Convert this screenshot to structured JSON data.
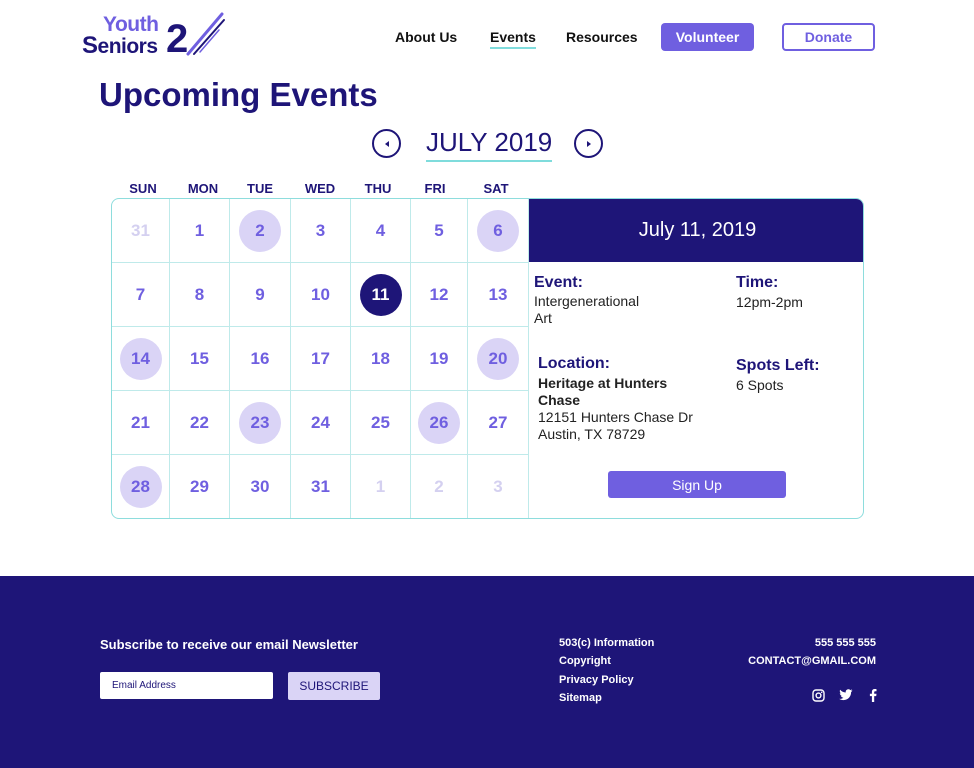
{
  "logo": {
    "word1": "Youth",
    "word2_cap": "S",
    "word2_rest": "eniors",
    "numeral": "2"
  },
  "nav": {
    "about": "About Us",
    "events": "Events",
    "resources": "Resources",
    "volunteer": "Volunteer",
    "donate": "Donate"
  },
  "page_title": "Upcoming Events",
  "calendar": {
    "month_label": "JULY 2019",
    "weekdays": [
      "SUN",
      "MON",
      "TUE",
      "WED",
      "THU",
      "FRI",
      "SAT"
    ],
    "weeks": [
      [
        {
          "d": "31",
          "state": "muted"
        },
        {
          "d": "1",
          "state": "normal"
        },
        {
          "d": "2",
          "state": "event"
        },
        {
          "d": "3",
          "state": "normal"
        },
        {
          "d": "4",
          "state": "normal"
        },
        {
          "d": "5",
          "state": "normal"
        },
        {
          "d": "6",
          "state": "event"
        }
      ],
      [
        {
          "d": "7",
          "state": "normal"
        },
        {
          "d": "8",
          "state": "normal"
        },
        {
          "d": "9",
          "state": "normal"
        },
        {
          "d": "10",
          "state": "normal"
        },
        {
          "d": "11",
          "state": "selected"
        },
        {
          "d": "12",
          "state": "normal"
        },
        {
          "d": "13",
          "state": "normal"
        }
      ],
      [
        {
          "d": "14",
          "state": "event"
        },
        {
          "d": "15",
          "state": "normal"
        },
        {
          "d": "16",
          "state": "normal"
        },
        {
          "d": "17",
          "state": "normal"
        },
        {
          "d": "18",
          "state": "normal"
        },
        {
          "d": "19",
          "state": "normal"
        },
        {
          "d": "20",
          "state": "event"
        }
      ],
      [
        {
          "d": "21",
          "state": "normal"
        },
        {
          "d": "22",
          "state": "normal"
        },
        {
          "d": "23",
          "state": "event"
        },
        {
          "d": "24",
          "state": "normal"
        },
        {
          "d": "25",
          "state": "normal"
        },
        {
          "d": "26",
          "state": "event"
        },
        {
          "d": "27",
          "state": "normal"
        }
      ],
      [
        {
          "d": "28",
          "state": "event"
        },
        {
          "d": "29",
          "state": "normal"
        },
        {
          "d": "30",
          "state": "normal"
        },
        {
          "d": "31",
          "state": "normal"
        },
        {
          "d": "1",
          "state": "muted"
        },
        {
          "d": "2",
          "state": "muted"
        },
        {
          "d": "3",
          "state": "muted"
        }
      ]
    ]
  },
  "detail": {
    "date": "July 11, 2019",
    "event_label": "Event:",
    "event_line1": "Intergenerational",
    "event_line2": "Art",
    "time_label": "Time:",
    "time_value": "12pm-2pm",
    "location_label": "Location:",
    "location_name_line1": "Heritage at Hunters",
    "location_name_line2": "Chase",
    "address_line1": "12151 Hunters Chase Dr",
    "address_line2": "Austin, TX 78729",
    "spots_label": "Spots Left:",
    "spots_value": "6 Spots",
    "signup": "Sign Up"
  },
  "footer": {
    "newsletter_title": "Subscribe to receive our email Newsletter",
    "email_placeholder": "Email Address",
    "subscribe": "SUBSCRIBE",
    "links": [
      "503(c) Information",
      "Copyright",
      "Privacy Policy",
      "Sitemap"
    ],
    "phone": "555 555 555",
    "email": "CONTACT@GMAIL.COM",
    "social_icons": [
      "instagram-icon",
      "twitter-icon",
      "facebook-icon"
    ]
  },
  "colors": {
    "navy": "#1e1578",
    "purple": "#6f5fe0",
    "lavender": "#dad4f6",
    "teal": "#7fdcdc"
  }
}
